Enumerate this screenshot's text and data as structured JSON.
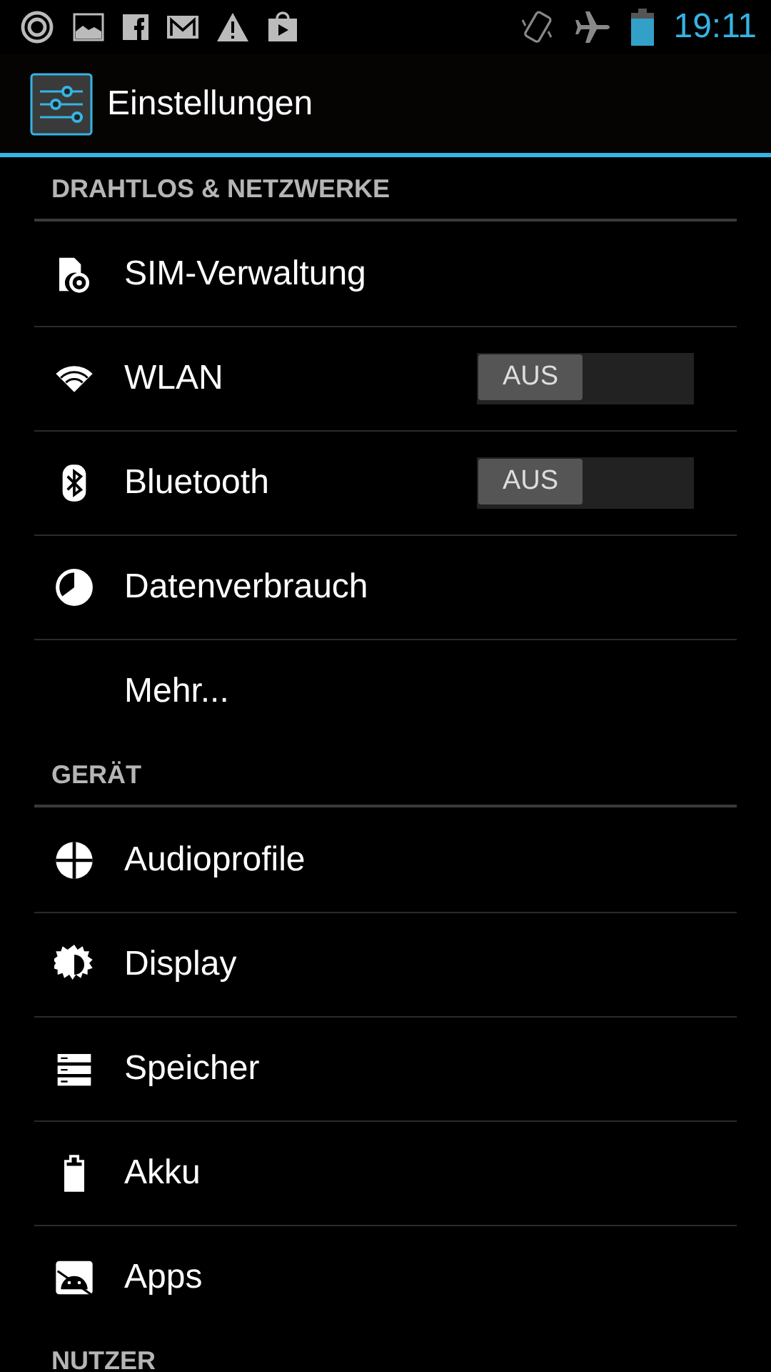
{
  "status_bar": {
    "time": "19:11"
  },
  "action_bar": {
    "title": "Einstellungen"
  },
  "sections": [
    {
      "header": "DRAHTLOS & NETZWERKE",
      "items": [
        {
          "label": "SIM-Verwaltung"
        },
        {
          "label": "WLAN",
          "toggle": {
            "on": false,
            "label": "AUS"
          }
        },
        {
          "label": "Bluetooth",
          "toggle": {
            "on": false,
            "label": "AUS"
          }
        },
        {
          "label": "Datenverbrauch"
        },
        {
          "label": "Mehr..."
        }
      ]
    },
    {
      "header": "GERÄT",
      "items": [
        {
          "label": "Audioprofile"
        },
        {
          "label": "Display"
        },
        {
          "label": "Speicher"
        },
        {
          "label": "Akku"
        },
        {
          "label": "Apps"
        }
      ]
    },
    {
      "header": "NUTZER"
    }
  ]
}
